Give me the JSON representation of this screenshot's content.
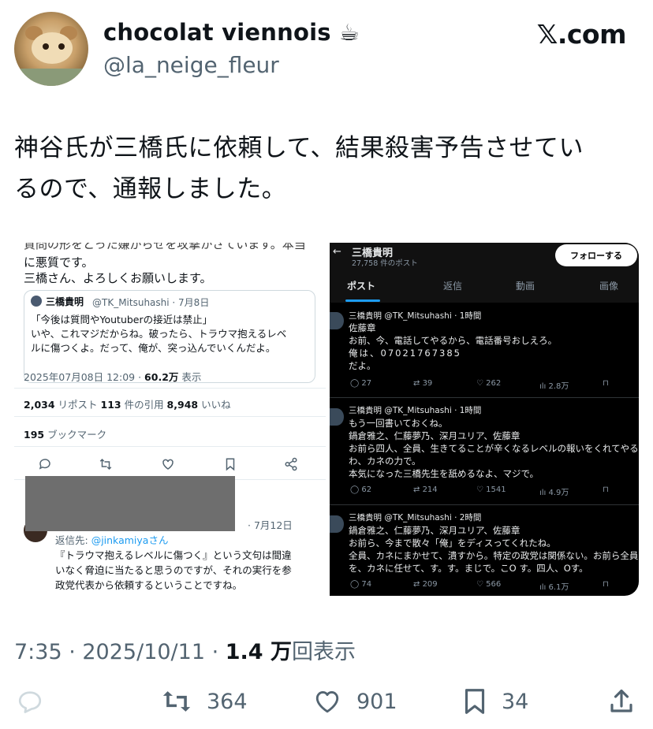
{
  "author": {
    "display_name": "chocolat viennois ☕",
    "handle": "@la_neige_fleur"
  },
  "brand": {
    "logo_text": "𝕏.com"
  },
  "tweet": {
    "text_line1": "神谷氏が三橋氏に依頼して、結果殺害予告させてい",
    "text_line2": "るので、通報しました。"
  },
  "left_image": {
    "line_cut": "質問の形をとった嫌がらせを攻撃かさています。本当",
    "line1": "に悪質です。",
    "line2": "三橋さん、よろしくお願いします。",
    "quote_name": "三橋貴明",
    "quote_handle_date": "@TK_Mitsuhashi · 7月8日",
    "quote_line1": "「今後は質問やYoutuberの接近は禁止」",
    "quote_line2": "いや、これマジだからね。破ったら、トラウマ抱えるレベ",
    "quote_line3": "ルに傷つくよ。だって、俺が、突っ込んでいくんだよ。",
    "timestamp": "2025年07月08日 12:09 · ",
    "views": "60.2万",
    "views_label": " 表示",
    "stats_reposts": "2,034",
    "stats_reposts_label": " リポスト  ",
    "stats_quotes": "113",
    "stats_quotes_label": " 件の引用  ",
    "stats_likes": "8,948",
    "stats_likes_label": " いいね",
    "bookmarks": "195",
    "bookmarks_label": " ブックマーク",
    "reply_date": "· 7月12日",
    "reply_to": "返信先: ",
    "reply_to_handle": "@jinkamiyaさん",
    "reply_line1": "『トラウマ抱えるレベルに傷つく』という文句は間違",
    "reply_line2": "いなく脅迫に当たると思うのですが、それの実行を参",
    "reply_line3": "政党代表から依頼するということですね。"
  },
  "right_image": {
    "profile_name": "三橋貴明",
    "post_count": "27,758 件のポスト",
    "follow_label": "フォローする",
    "tabs": [
      "ポスト",
      "返信",
      "動画",
      "画像"
    ],
    "posts": [
      {
        "header": "三橋貴明 @TK_Mitsuhashi · 1時間",
        "lines": [
          "佐藤章",
          "お前、今、電話してやるから、電話番号おしえろ。",
          "俺は、07021767385",
          "だよ。"
        ],
        "replies": "27",
        "reposts": "39",
        "likes": "262",
        "views": "2.8万"
      },
      {
        "header": "三橋貴明 @TK_Mitsuhashi · 1時間",
        "lines": [
          "もう一回書いておくね。",
          "鍋倉雅之、仁藤夢乃、深月ユリア、佐藤章",
          "お前ら四人、全員、生きてることが辛くなるレベルの報いをくれてやる",
          "わ、カネの力で。",
          "本気になった三橋先生を舐めるなよ、マジで。"
        ],
        "replies": "62",
        "reposts": "214",
        "likes": "1541",
        "views": "4.9万"
      },
      {
        "header": "三橋貴明 @TK_Mitsuhashi · 2時間",
        "lines": [
          "鍋倉雅之、仁藤夢乃、深月ユリア、佐藤章",
          "お前ら、今まで散々「俺」をディスってくれたね。",
          "全員、カネにまかせて、潰すから。特定の政党は関係ない。お前ら全員",
          "を、カネに任せて、す。す。まじで。こO す。四人、Oす。"
        ],
        "replies": "74",
        "reposts": "209",
        "likes": "566",
        "views": "6.1万"
      }
    ]
  },
  "meta": {
    "time_date": "7:35 · 2025/10/11 · ",
    "views": "1.4 万",
    "views_label": "回表示"
  },
  "actions": {
    "reposts": "364",
    "likes": "901",
    "bookmarks": "34"
  },
  "colors": {
    "text": "#0f1419",
    "secondary": "#536471",
    "accent": "#1d9bf0"
  },
  "icons": [
    "reply-icon",
    "repost-icon",
    "like-icon",
    "bookmark-icon",
    "share-icon"
  ]
}
